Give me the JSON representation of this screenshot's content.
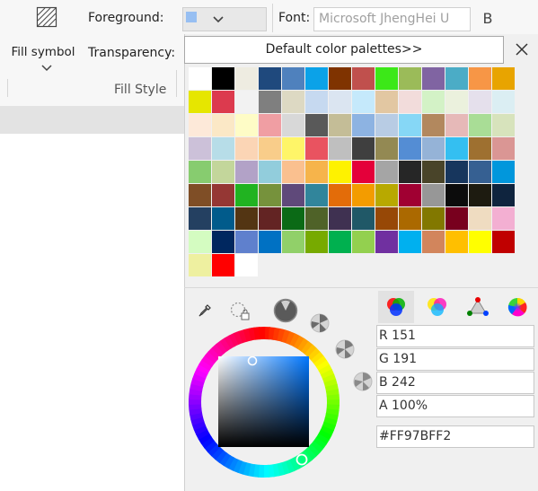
{
  "ribbon": {
    "fill_symbol_label": "Fill symbol",
    "foreground_label": "Foreground:",
    "foreground_color": "#97BFF2",
    "transparency_label": "Transparency:",
    "font_label": "Font:",
    "font_value": "Microsoft JhengHei U",
    "bold_label": "B",
    "group_label": "Fill Style"
  },
  "popup": {
    "palette_button_label": "Default color palettes>>",
    "close_icon": "close-icon",
    "palette_rows": [
      [
        "#ffffff",
        "#000000",
        "#eeece1",
        "#1f497d",
        "#4f81bd",
        "#0ba2e8",
        "#7f3300",
        "#c0504d",
        "#3ce818",
        "#9bbb59",
        "#8064a2",
        "#4bacc6",
        "#f79646",
        "#e8a400"
      ],
      [
        "#e6e600",
        "#dc3a4e",
        "#f2f2f2",
        "#7f7f7f",
        "#ddd9c3",
        "#c6d9f0",
        "#dbe5f1",
        "#c5e9fb",
        "#e2c7a2",
        "#f2dcdb",
        "#d3f2c6",
        "#ebf1dd",
        "#e5e0ec",
        "#dbeef3"
      ],
      [
        "#fde9d9",
        "#fbe8c6",
        "#fefcc6",
        "#f09ea3",
        "#d8d8d8",
        "#595959",
        "#c4bd97",
        "#8db3e2",
        "#b8cce4",
        "#86d7f6",
        "#b2885e",
        "#e6b9b8",
        "#a9dd96",
        "#d7e3bc"
      ],
      [
        "#ccc1d9",
        "#b7dde8",
        "#fbd5b5",
        "#f9cd8a",
        "#fef568",
        "#e95360",
        "#bfbfbf",
        "#3f3f3f",
        "#938953",
        "#548dd4",
        "#95b3d7",
        "#34bff1",
        "#9e7030",
        "#da9694"
      ],
      [
        "#87cc6f",
        "#c3d69b",
        "#b2a2c7",
        "#92cddc",
        "#fac08f",
        "#f6b44b",
        "#fef200",
        "#e4003a",
        "#a5a5a5",
        "#262626",
        "#494429",
        "#17365d",
        "#366092",
        "#0197dc"
      ],
      [
        "#7f4e26",
        "#953734",
        "#21b321",
        "#76923c",
        "#5f497a",
        "#31859b",
        "#e36c09",
        "#f39c00",
        "#b8a900",
        "#a00032",
        "#979797",
        "#0c0c0c",
        "#1d1b10",
        "#0f243e"
      ],
      [
        "#244061",
        "#015b8b",
        "#533513",
        "#632423",
        "#0b6a16",
        "#4f6228",
        "#3f3151",
        "#205867",
        "#974806",
        "#ab6900",
        "#827800",
        "#78001e",
        "#efdcc1",
        "#f3afd2"
      ],
      [
        "#d4fcc1",
        "#00275f",
        "#5f80cd",
        "#0071c3",
        "#91d069",
        "#77aa00",
        "#00b04f",
        "#93d04f",
        "#7030a0",
        "#00b0ef",
        "#d2855c",
        "#ffbf00",
        "#ffff00",
        "#c00000"
      ],
      [
        "#eef0a0",
        "#ff0000",
        "#ffffff"
      ]
    ]
  },
  "picker": {
    "eyedropper_icon": "eyedropper-icon",
    "lasso_icon": "lasso-lock-icon",
    "tabs": [
      "rgb-circles-icon",
      "cmy-circles-icon",
      "hsv-triangle-icon",
      "color-wheel-icon"
    ],
    "r_field": "R 151",
    "g_field": "G 191",
    "b_field": "B 242",
    "a_field": "A 100%",
    "hex_field": "#FF97BFF2",
    "hue_color": "#0077ff"
  }
}
